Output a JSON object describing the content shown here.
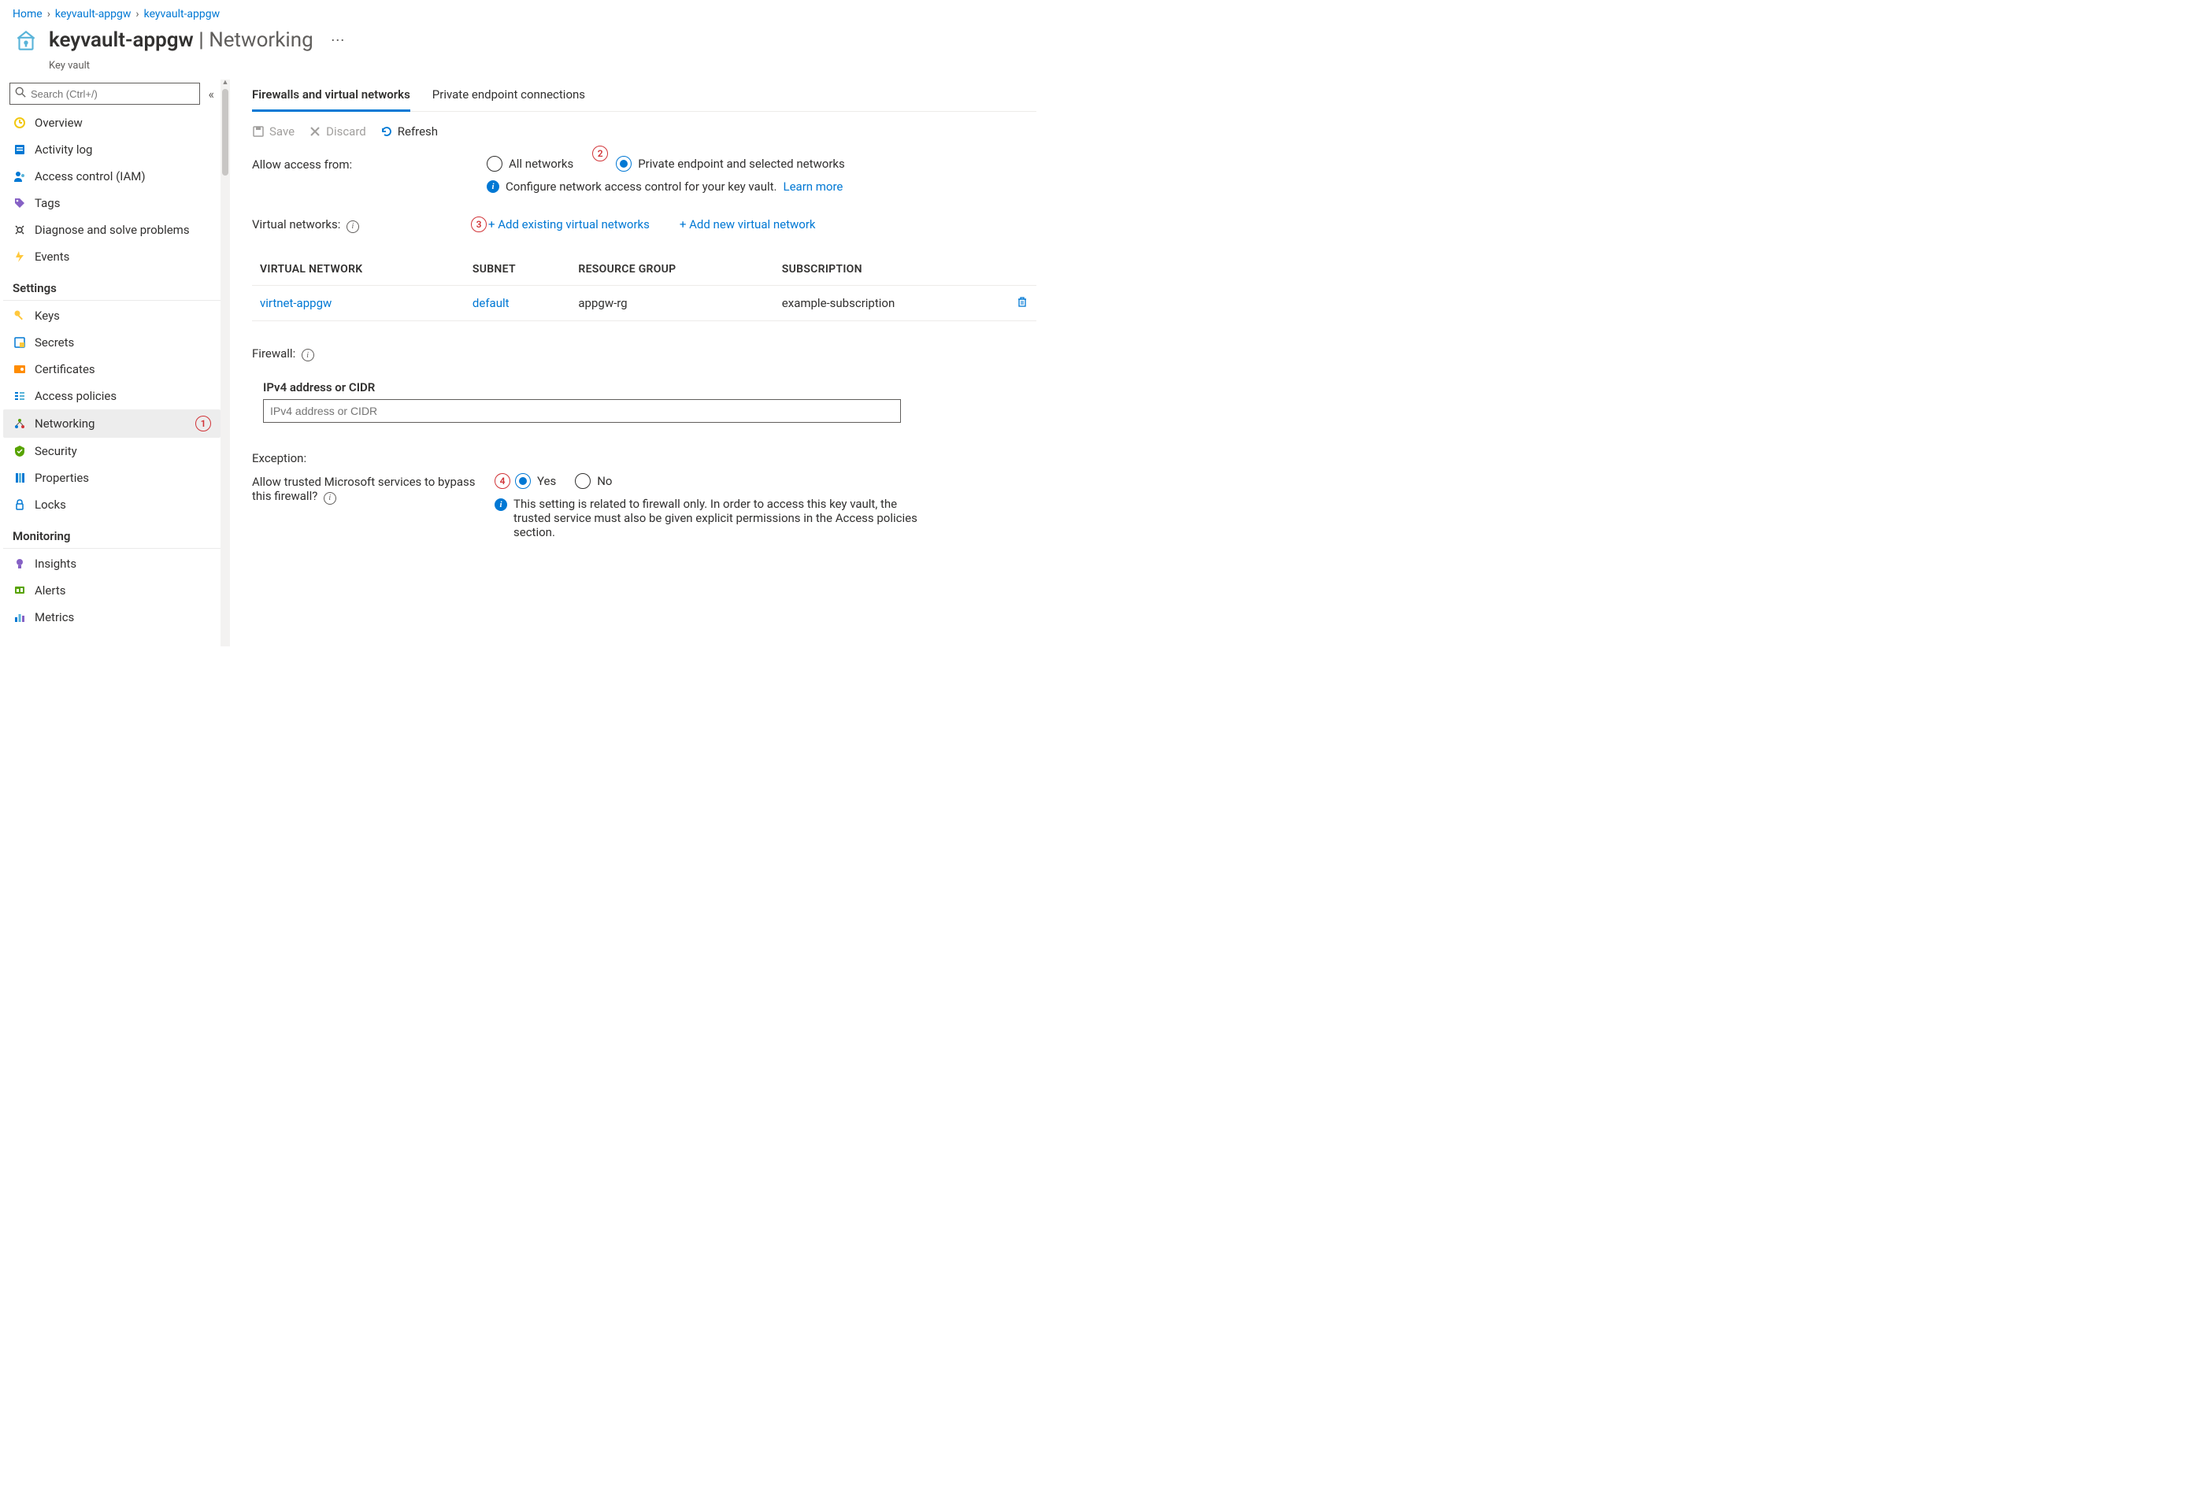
{
  "breadcrumb": {
    "home": "Home",
    "l1": "keyvault-appgw",
    "l2": "keyvault-appgw"
  },
  "header": {
    "title": "keyvault-appgw",
    "section": "Networking",
    "subtype": "Key vault"
  },
  "search": {
    "placeholder": "Search (Ctrl+/)"
  },
  "nav": {
    "top": [
      {
        "label": "Overview"
      },
      {
        "label": "Activity log"
      },
      {
        "label": "Access control (IAM)"
      },
      {
        "label": "Tags"
      },
      {
        "label": "Diagnose and solve problems"
      },
      {
        "label": "Events"
      }
    ],
    "settings_title": "Settings",
    "settings": [
      {
        "label": "Keys"
      },
      {
        "label": "Secrets"
      },
      {
        "label": "Certificates"
      },
      {
        "label": "Access policies"
      },
      {
        "label": "Networking"
      },
      {
        "label": "Security"
      },
      {
        "label": "Properties"
      },
      {
        "label": "Locks"
      }
    ],
    "monitoring_title": "Monitoring",
    "monitoring": [
      {
        "label": "Insights"
      },
      {
        "label": "Alerts"
      },
      {
        "label": "Metrics"
      }
    ]
  },
  "tabs": {
    "t0": "Firewalls and virtual networks",
    "t1": "Private endpoint connections"
  },
  "toolbar": {
    "save": "Save",
    "discard": "Discard",
    "refresh": "Refresh"
  },
  "allow": {
    "label": "Allow access from:",
    "opt_all": "All networks",
    "opt_sel": "Private endpoint and selected networks",
    "info_text": "Configure network access control for your key vault.",
    "learn_more": "Learn more"
  },
  "vnets": {
    "label": "Virtual networks:",
    "add_existing": "+ Add existing virtual networks",
    "add_new": "+ Add new virtual network",
    "cols": {
      "vnet": "VIRTUAL NETWORK",
      "subnet": "SUBNET",
      "rg": "RESOURCE GROUP",
      "sub": "SUBSCRIPTION"
    },
    "rows": [
      {
        "vnet": "virtnet-appgw",
        "subnet": "default",
        "rg": "appgw-rg",
        "sub": "example-subscription"
      }
    ]
  },
  "firewall": {
    "label": "Firewall:",
    "ipv4_header": "IPv4 address or CIDR",
    "ipv4_placeholder": "IPv4 address or CIDR"
  },
  "exception": {
    "title": "Exception:",
    "question": "Allow trusted Microsoft services to bypass this firewall?",
    "yes": "Yes",
    "no": "No",
    "info": "This setting is related to firewall only. In order to access this key vault, the trusted service must also be given explicit permissions in the Access policies section."
  },
  "annotations": {
    "a1": "1",
    "a2": "2",
    "a3": "3",
    "a4": "4"
  }
}
